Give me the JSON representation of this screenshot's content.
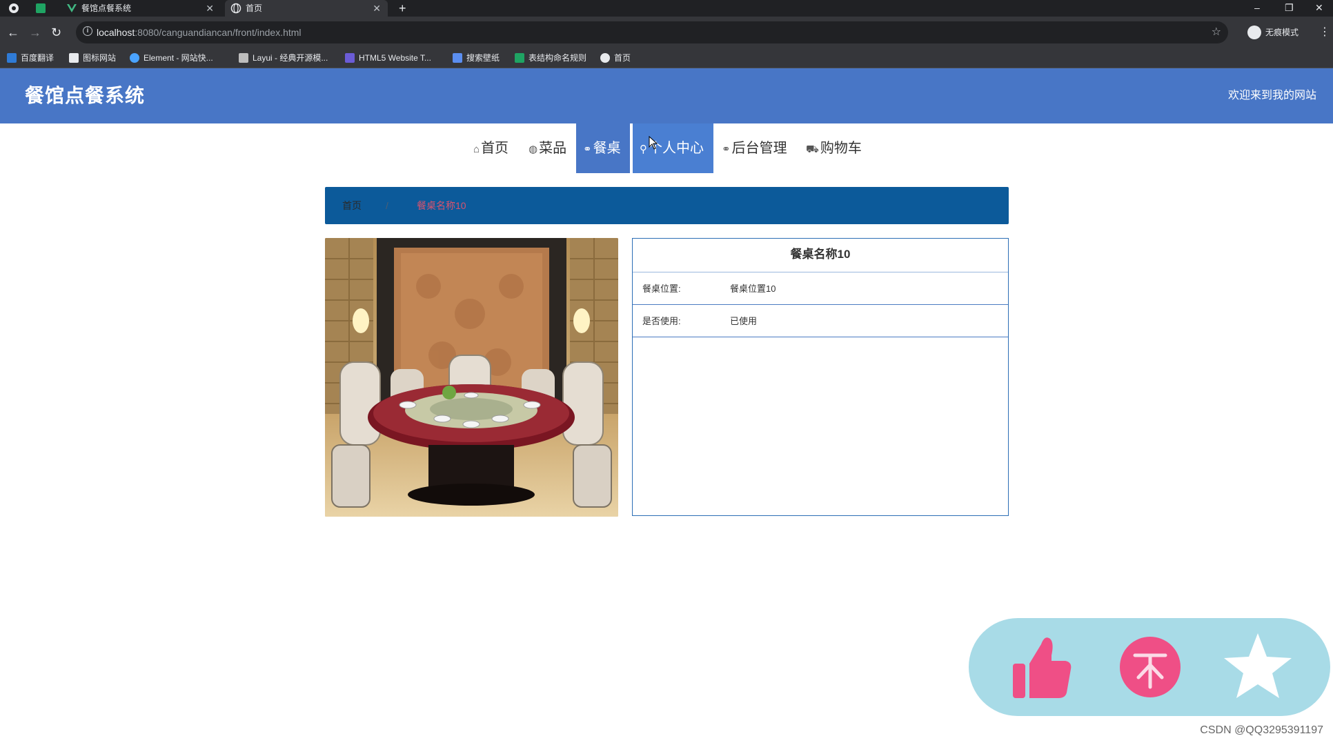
{
  "browser": {
    "tabs": [
      {
        "label": "餐馆点餐系统",
        "active": false
      },
      {
        "label": "首页",
        "active": true
      }
    ],
    "new_tab_label": "+",
    "url_host": "localhost",
    "url_path": ":8080/canguandiancan/front/index.html",
    "incognito_label": "无痕模式",
    "bookmarks": [
      {
        "label": "百度翻译",
        "color": "#2f7bd6"
      },
      {
        "label": "图标网站",
        "color": "#e8eaed"
      },
      {
        "label": "Element - 网站快...",
        "color": "#4aa3ff"
      },
      {
        "label": "Layui - 经典开源模...",
        "color": "#bdbdbd"
      },
      {
        "label": "HTML5 Website T...",
        "color": "#6b5cd6"
      },
      {
        "label": "搜索壁纸",
        "color": "#5b8ef0"
      },
      {
        "label": "表结构命名规则",
        "color": "#1fa463"
      },
      {
        "label": "首页",
        "color": "#e8eaed"
      }
    ]
  },
  "header": {
    "site_title": "餐馆点餐系统",
    "welcome": "欢迎来到我的网站",
    "brand_color": "#4876c6"
  },
  "nav": [
    {
      "label": "首页",
      "icon": "home-icon",
      "state": "normal"
    },
    {
      "label": "菜品",
      "icon": "globe-icon",
      "state": "normal"
    },
    {
      "label": "餐桌",
      "icon": "link-icon",
      "state": "active"
    },
    {
      "label": "个人中心",
      "icon": "user-icon",
      "state": "hover"
    },
    {
      "label": "后台管理",
      "icon": "link-icon",
      "state": "normal"
    },
    {
      "label": "购物车",
      "icon": "cart-icon",
      "state": "normal"
    }
  ],
  "breadcrumb": {
    "home": "首页",
    "separator": "/",
    "current": "餐桌名称10"
  },
  "detail": {
    "title": "餐桌名称10",
    "fields": [
      {
        "label": "餐桌位置:",
        "value": "餐桌位置10"
      },
      {
        "label": "是否使用:",
        "value": "已使用"
      }
    ]
  },
  "actions": {
    "like_icon": "thumbs-up-icon",
    "top_icon": "back-to-top-icon",
    "favorite_icon": "star-icon",
    "bar_color": "#a8dbe7",
    "accent": "#ef4f86"
  },
  "watermark": "CSDN @QQ3295391197"
}
